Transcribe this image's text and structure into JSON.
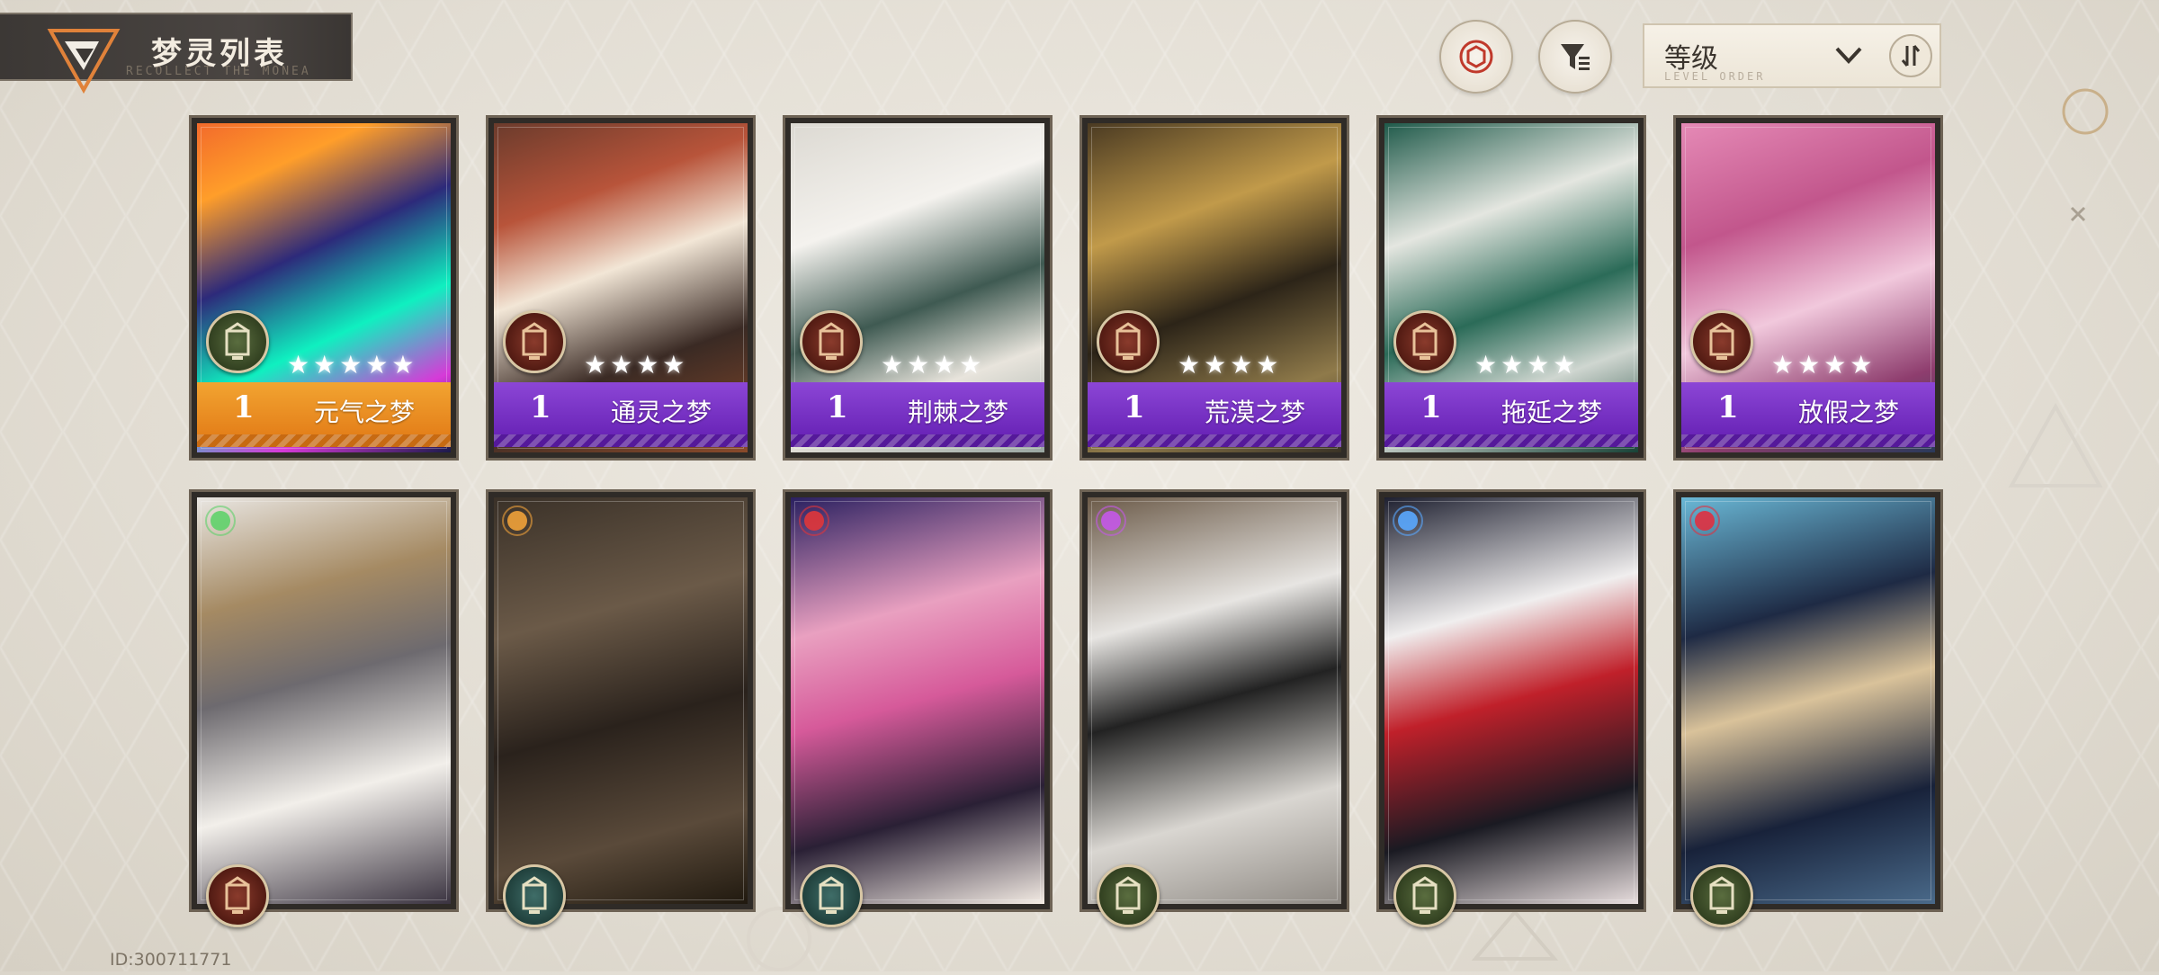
{
  "header": {
    "title": "梦灵列表",
    "subtitle": "RECOLLECT THE MONEA"
  },
  "controls": {
    "sort_label": "等级",
    "sort_sub": "LEVEL ORDER"
  },
  "dream_cards": [
    {
      "level": "1",
      "name": "元气之梦",
      "stars": "★★★★★",
      "bar": "orange",
      "badge": "green"
    },
    {
      "level": "1",
      "name": "通灵之梦",
      "stars": "★★★★",
      "bar": "purple",
      "badge": "red"
    },
    {
      "level": "1",
      "name": "荆棘之梦",
      "stars": "★★★★",
      "bar": "purple",
      "badge": "red"
    },
    {
      "level": "1",
      "name": "荒漠之梦",
      "stars": "★★★★",
      "bar": "purple",
      "badge": "red"
    },
    {
      "level": "1",
      "name": "拖延之梦",
      "stars": "★★★★",
      "bar": "purple",
      "badge": "red"
    },
    {
      "level": "1",
      "name": "放假之梦",
      "stars": "★★★★",
      "bar": "purple",
      "badge": "red"
    }
  ],
  "character_cards": [
    {
      "element_icon": "green-orbit-icon",
      "badge": "red"
    },
    {
      "element_icon": "orange-orb-icon",
      "badge": "teal"
    },
    {
      "element_icon": "red-gem-icon",
      "badge": "teal"
    },
    {
      "element_icon": "purple-spirit-icon",
      "badge": "green"
    },
    {
      "element_icon": "blue-crystal-icon",
      "badge": "green"
    },
    {
      "element_icon": "red-flame-icon",
      "badge": "green"
    }
  ],
  "footer": {
    "uid": "ID:300711771"
  },
  "colors": {
    "accent_orange": "#e4801a",
    "accent_purple": "#7a2fc6",
    "frame": "#6e6355"
  }
}
